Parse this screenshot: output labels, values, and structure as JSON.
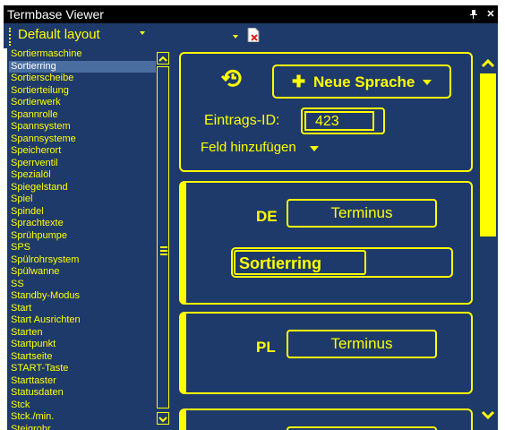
{
  "window": {
    "title": "Termbase Viewer"
  },
  "toolbar": {
    "layout_label": "Default layout"
  },
  "terms": [
    "Sortiermaschine",
    "Sortierring",
    "Sortierscheibe",
    "Sortierteilung",
    "Sortierwerk",
    "Spannrolle",
    "Spannsystem",
    "Spannsysteme",
    "Speicherort",
    "Sperrventil",
    "Spezialöl",
    "Spiegelstand",
    "Spiel",
    "Spindel",
    "Sprachtexte",
    "Sprühpumpe",
    "SPS",
    "Spülrohrsystem",
    "Spülwanne",
    "SS",
    "Standby-Modus",
    "Start",
    "Start Ausrichten",
    "Starten",
    "Startpunkt",
    "Startseite",
    "START-Taste",
    "Starttaster",
    "Statusdaten",
    "Stck",
    "Stck./min.",
    "Steigrohr"
  ],
  "selected_term": "Sortierring",
  "entry": {
    "add_language_label": "Neue Sprache",
    "entry_id_label": "Eintrags-ID:",
    "entry_id_value": "423",
    "add_field_label": "Feld hinzufügen"
  },
  "languages": [
    {
      "code": "DE",
      "terminus_label": "Terminus",
      "term": "Sortierring"
    },
    {
      "code": "PL",
      "terminus_label": "Terminus"
    }
  ],
  "colors": {
    "background": "#1e3a6b",
    "accent": "#ffff00",
    "selection": "#4a6ea0"
  }
}
